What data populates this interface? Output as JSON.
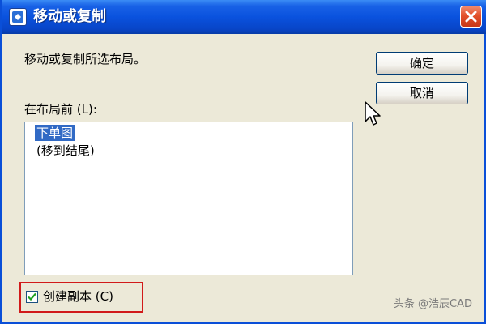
{
  "window": {
    "title": "移动或复制"
  },
  "dialog": {
    "instruction": "移动或复制所选布局。",
    "ok_label": "确定",
    "cancel_label": "取消",
    "list_label": "在布局前 (L):",
    "list_items": [
      "下单图",
      "(移到结尾)"
    ],
    "selected_index": 0,
    "checkbox_label": "创建副本 (C)",
    "checkbox_checked": true
  },
  "watermark": {
    "text": "头条 @浩辰CAD"
  },
  "colors": {
    "titlebar": "#0a52de",
    "selection": "#316ac5",
    "highlight_box": "#d11a1a",
    "dialog_bg": "#ece9d8"
  }
}
